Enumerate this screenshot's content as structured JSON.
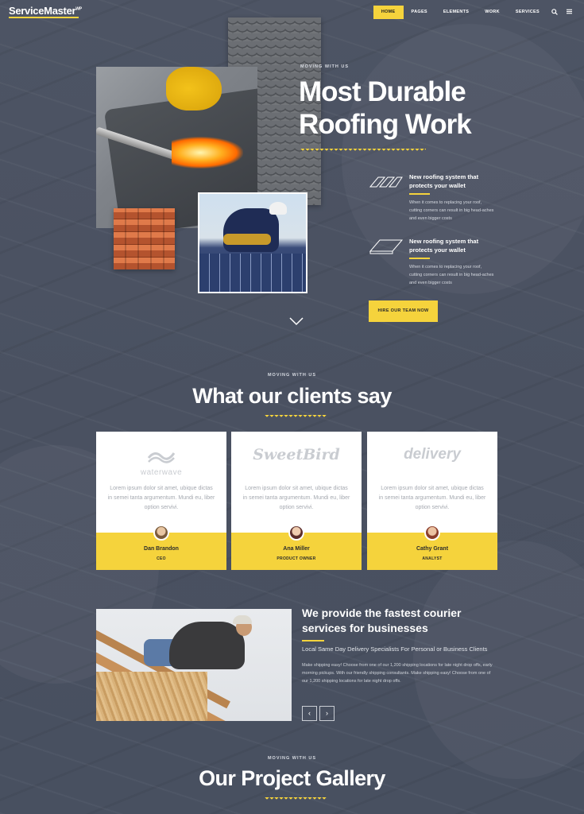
{
  "nav": {
    "logo": "ServiceMaster",
    "logo_suffix": "WP",
    "items": [
      "HOME",
      "PAGES",
      "ELEMENTS",
      "WORK",
      "SERVICES"
    ],
    "active_index": 0,
    "search_icon": "search-icon",
    "menu_icon": "hamburger-icon"
  },
  "hero": {
    "eyebrow": "MOVING WITH US",
    "title_line1": "Most Durable",
    "title_line2": "Roofing Work",
    "features": [
      {
        "icon": "roof-tiles-icon",
        "title": "New roofing system that protects your wallet",
        "text": "When it comes to replacing your roof, cutting corners can result in big head-aches and even bigger costs"
      },
      {
        "icon": "roof-panel-icon",
        "title": "New roofing system that protects your wallet",
        "text": "When it comes to replacing your roof, cutting corners can result in big head-aches and even bigger costs"
      }
    ],
    "cta": "HIRE OUR TEAM NOW",
    "scroll_icon": "chevron-down-icon"
  },
  "testimonials": {
    "eyebrow": "MOVING WITH US",
    "title": "What our clients say",
    "cards": [
      {
        "brand": "waterwave",
        "quote": "Lorem ipsum dolor sit amet, ubique dictas in semei tanta argumentum. Mundi eu, liber option servivi.",
        "name": "Dan Brandon",
        "role": "CEO"
      },
      {
        "brand": "SweetBird",
        "quote": "Lorem ipsum dolor sit amet, ubique dictas in semei tanta argumentum. Mundi eu, liber option servivi.",
        "name": "Ana Miller",
        "role": "PRODUCT OWNER"
      },
      {
        "brand": "delivery",
        "quote": "Lorem ipsum dolor sit amet, ubique dictas in semei tanta argumentum. Mundi eu, liber option servivi.",
        "name": "Cathy Grant",
        "role": "ANALYST"
      }
    ]
  },
  "courier": {
    "title": "We provide the fastest courier services for businesses",
    "subtitle": "Local Same Day Delivery Specialists For Personal or Business Clients",
    "text": "Make shipping easy! Choose from one of our 1,200 shipping locations for late night drop offs, early morning pickups. With our friendly shipping consultants. Make shipping easy! Choose from one of our 1,200 shipping locations for late night drop offs.",
    "prev": "‹",
    "next": "›"
  },
  "gallery": {
    "eyebrow": "MOVING WITH US",
    "title": "Our Project Gallery"
  },
  "colors": {
    "accent": "#f5d33c",
    "background": "#4b5262",
    "card": "#ffffff"
  }
}
